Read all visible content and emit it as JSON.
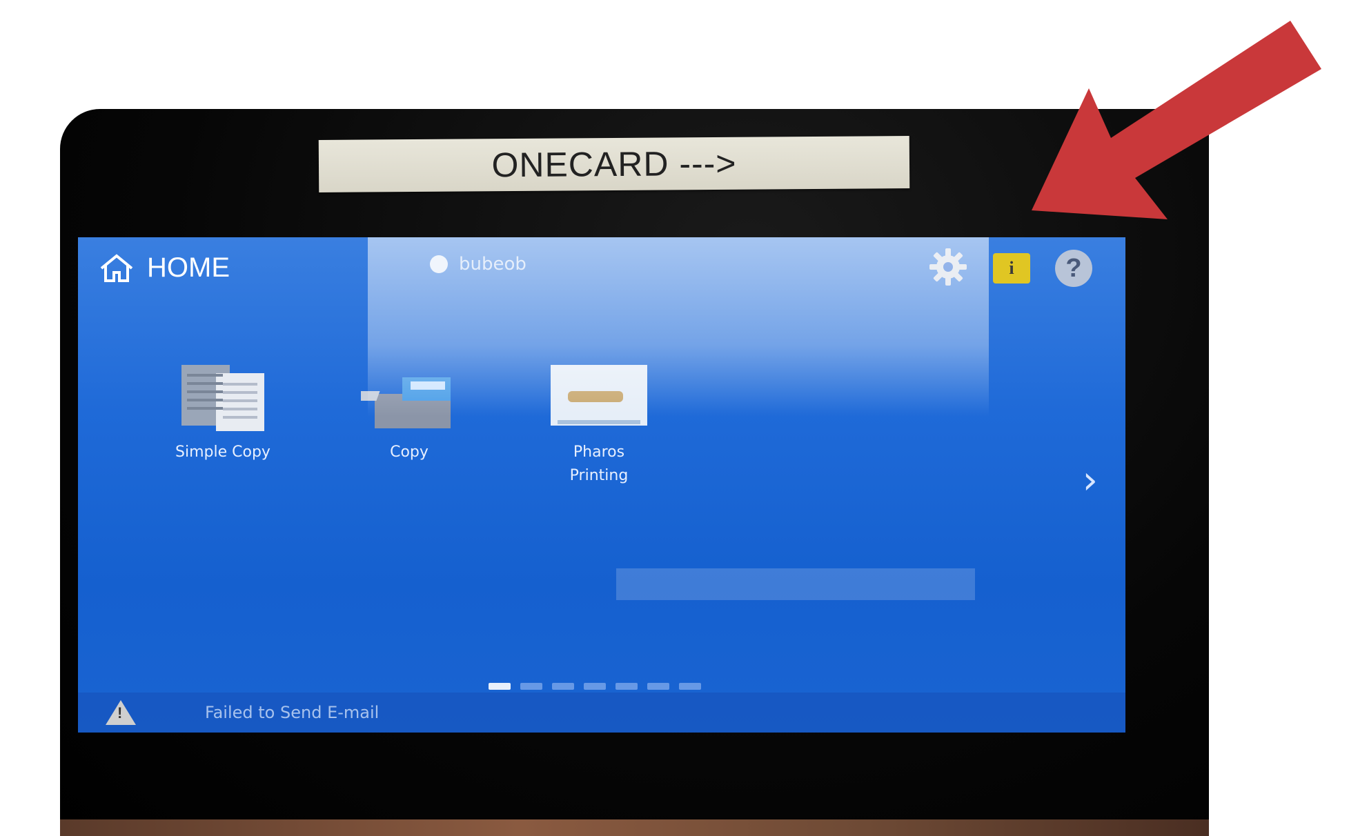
{
  "label_strip": {
    "text": "ONECARD --->"
  },
  "header": {
    "home_label": "HOME",
    "user_label": "bubeob"
  },
  "toolbar": {
    "settings_icon": "gear-icon",
    "info_icon_text": "i",
    "help_icon_text": "?"
  },
  "apps": [
    {
      "label_1": "Simple Copy",
      "label_2": ""
    },
    {
      "label_1": "Copy",
      "label_2": ""
    },
    {
      "label_1": "Pharos",
      "label_2": "Printing"
    }
  ],
  "pager": {
    "pages": 7,
    "current": 1
  },
  "status": {
    "message": "Failed to Send E-mail"
  },
  "colors": {
    "screen_blue": "#1f6ad8",
    "annotation_arrow": "#c9383a",
    "info_yellow": "#e0c623"
  }
}
